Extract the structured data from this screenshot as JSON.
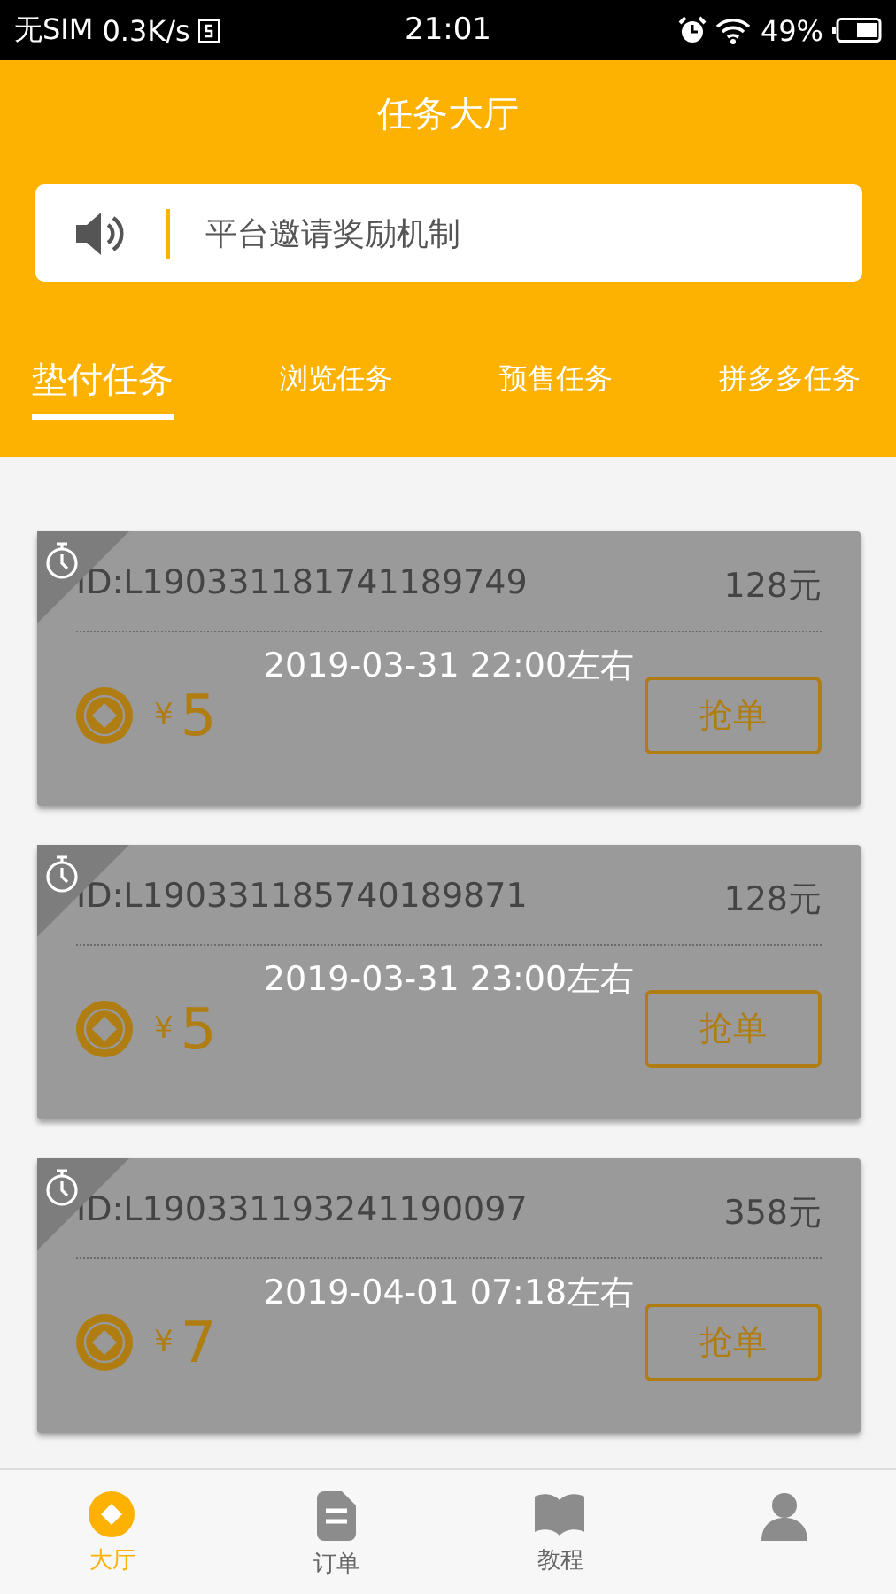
{
  "status_bar": {
    "carrier": "无SIM",
    "speed": "0.3K/s",
    "time": "21:01",
    "battery": "49%"
  },
  "header": {
    "title": "任务大厅"
  },
  "notice": {
    "text": "平台邀请奖励机制"
  },
  "tabs": [
    {
      "label": "垫付任务",
      "selected": true
    },
    {
      "label": "浏览任务",
      "selected": false
    },
    {
      "label": "预售任务",
      "selected": false
    },
    {
      "label": "拼多多任务",
      "selected": false
    }
  ],
  "tasks": [
    {
      "id": "ID:L190331181741189749",
      "amount": "128元",
      "time": "2019-03-31 22:00左右",
      "currency": "¥",
      "reward": "5",
      "button": "抢单"
    },
    {
      "id": "ID:L190331185740189871",
      "amount": "128元",
      "time": "2019-03-31 23:00左右",
      "currency": "¥",
      "reward": "5",
      "button": "抢单"
    },
    {
      "id": "ID:L190331193241190097",
      "amount": "358元",
      "time": "2019-04-01 07:18左右",
      "currency": "¥",
      "reward": "7",
      "button": "抢单"
    }
  ],
  "nav": [
    {
      "label": "大厅",
      "kind": "hall",
      "selected": true
    },
    {
      "label": "订单",
      "kind": "order",
      "selected": false
    },
    {
      "label": "教程",
      "kind": "guide",
      "selected": false
    },
    {
      "kind": "me",
      "selected": false
    }
  ]
}
